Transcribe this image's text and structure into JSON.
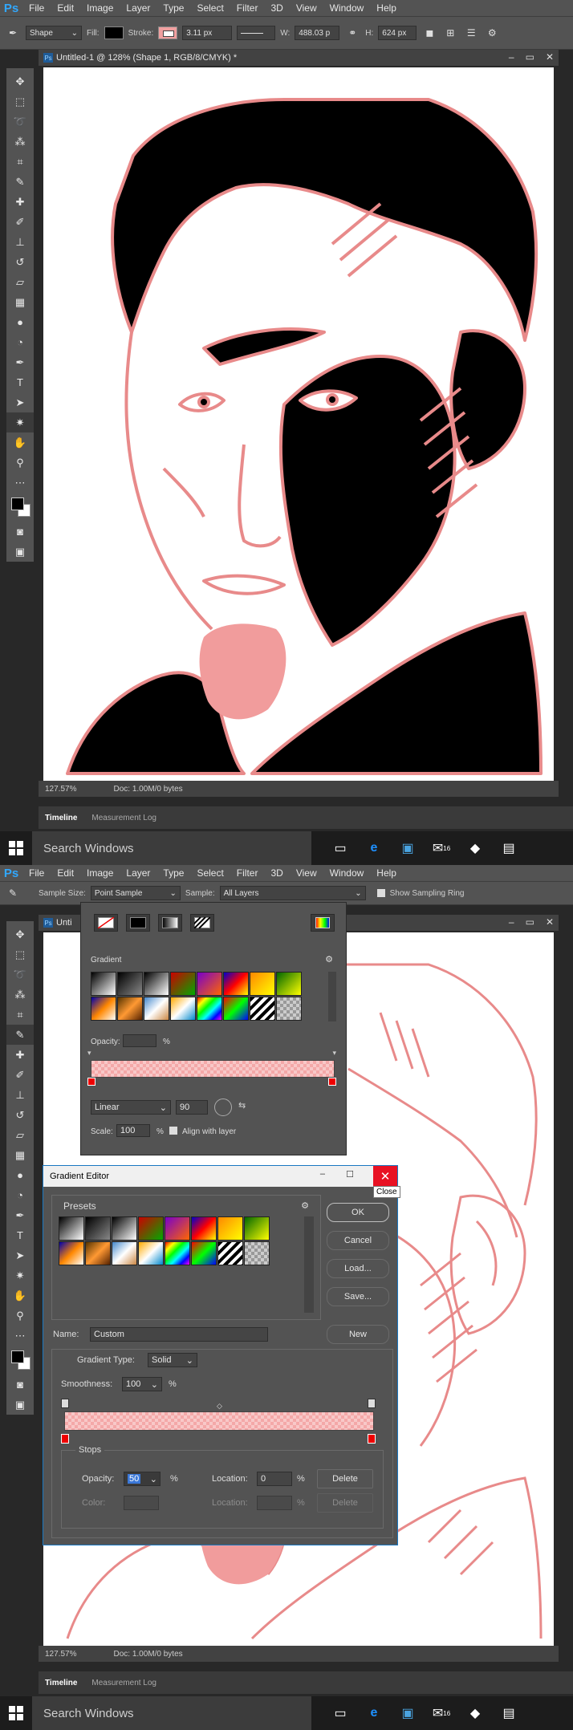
{
  "menu": [
    "File",
    "Edit",
    "Image",
    "Layer",
    "Type",
    "Select",
    "Filter",
    "3D",
    "View",
    "Window",
    "Help"
  ],
  "app_logo": "Ps",
  "screen1": {
    "options": {
      "mode": "Shape",
      "fill_label": "Fill:",
      "stroke_label": "Stroke:",
      "stroke_width": "3.11 px",
      "w_label": "W:",
      "w_value": "488.03 p",
      "h_label": "H:",
      "h_value": "624 px"
    },
    "doc_title": "Untitled-1 @ 128% (Shape 1, RGB/8/CMYK) *",
    "zoom": "127.57%",
    "doc_info": "Doc: 1.00M/0 bytes"
  },
  "screen2": {
    "options": {
      "sample_size_label": "Sample Size:",
      "sample_size_value": "Point Sample",
      "sample_label": "Sample:",
      "sample_value": "All Layers",
      "show_ring": "Show Sampling Ring"
    },
    "doc_title_partial": "Unti",
    "zoom": "127.57%",
    "doc_info": "Doc: 1.00M/0 bytes",
    "gradient_panel": {
      "gradient_label": "Gradient",
      "opacity_label": "Opacity:",
      "percent": "%",
      "style": "Linear",
      "angle": "90",
      "scale_label": "Scale:",
      "scale_value": "100",
      "align_label": "Align with layer"
    },
    "gradient_editor": {
      "title": "Gradient Editor",
      "close_tooltip": "Close",
      "presets_label": "Presets",
      "ok": "OK",
      "cancel": "Cancel",
      "load": "Load...",
      "save": "Save...",
      "name_label": "Name:",
      "name_value": "Custom",
      "new_label": "New",
      "type_label": "Gradient Type:",
      "type_value": "Solid",
      "smoothness_label": "Smoothness:",
      "smoothness_value": "100",
      "percent": "%",
      "stops_label": "Stops",
      "opacity_label": "Opacity:",
      "opacity_value": "50",
      "location_label": "Location:",
      "location_value": "0",
      "delete_label": "Delete",
      "color_label": "Color:",
      "location2_label": "Location:",
      "delete2_label": "Delete"
    }
  },
  "timeline_tab": "Timeline",
  "measurement_tab": "Measurement Log",
  "taskbar_search": "Search Windows",
  "mail_badge": "16",
  "colors": {
    "stroke_pink": "#e88a8a",
    "ps_blue": "#31a8ff",
    "close_red": "#e81123"
  }
}
